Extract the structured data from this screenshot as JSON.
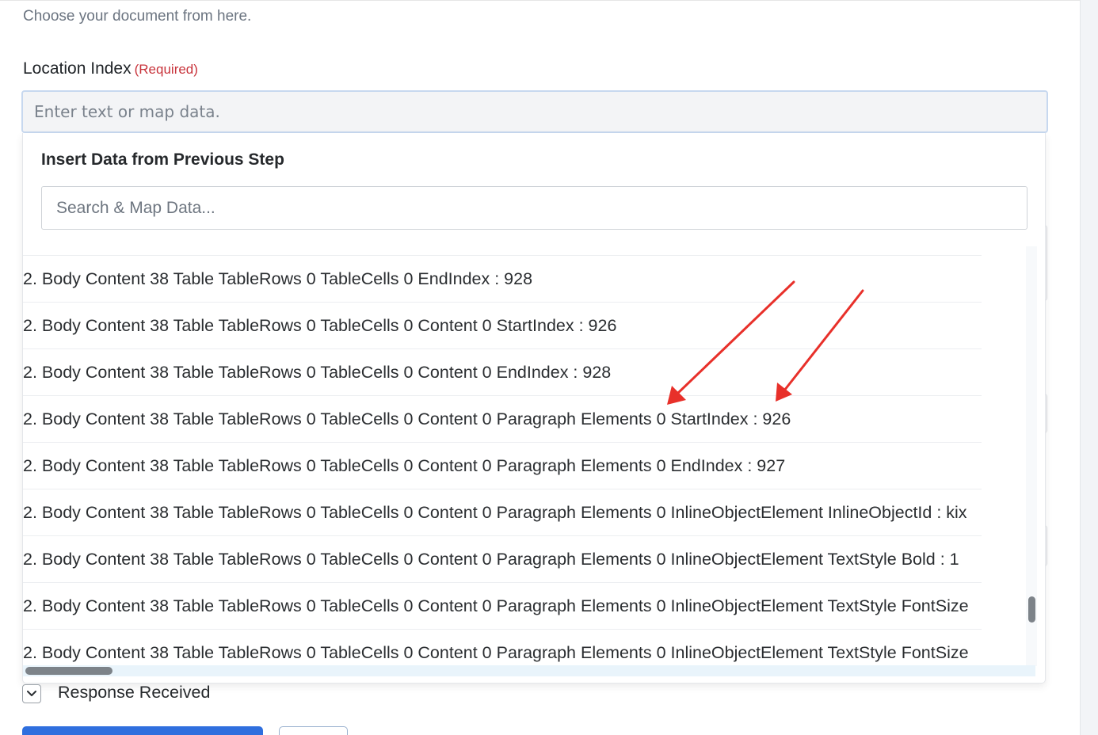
{
  "form": {
    "helper_text": "Choose your document from here.",
    "location_label": "Location Index",
    "required_text": "(Required)",
    "location_placeholder": "Enter text or map data."
  },
  "dropdown": {
    "title": "Insert Data from Previous Step",
    "search_placeholder": "Search & Map Data...",
    "options": [
      "2. Body Content 38 Table TableRows 0 TableCells 0 EndIndex : 928",
      "2. Body Content 38 Table TableRows 0 TableCells 0 Content 0 StartIndex : 926",
      "2. Body Content 38 Table TableRows 0 TableCells 0 Content 0 EndIndex : 928",
      "2. Body Content 38 Table TableRows 0 TableCells 0 Content 0 Paragraph Elements 0 StartIndex : 926",
      "2. Body Content 38 Table TableRows 0 TableCells 0 Content 0 Paragraph Elements 0 EndIndex : 927",
      "2. Body Content 38 Table TableRows 0 TableCells 0 Content 0 Paragraph Elements 0 InlineObjectElement InlineObjectId : kix",
      "2. Body Content 38 Table TableRows 0 TableCells 0 Content 0 Paragraph Elements 0 InlineObjectElement TextStyle Bold : 1",
      "2. Body Content 38 Table TableRows 0 TableCells 0 Content 0 Paragraph Elements 0 InlineObjectElement TextStyle FontSize",
      "2. Body Content 38 Table TableRows 0 TableCells 0 Content 0 Paragraph Elements 0 InlineObjectElement TextStyle FontSize"
    ]
  },
  "response": {
    "label": "Response Received"
  },
  "colors": {
    "accent": "#2f6fde",
    "required": "#c8333b",
    "annotation_arrow": "#e8302a"
  },
  "icons": {
    "response_toggle": "chevron-down-icon"
  }
}
